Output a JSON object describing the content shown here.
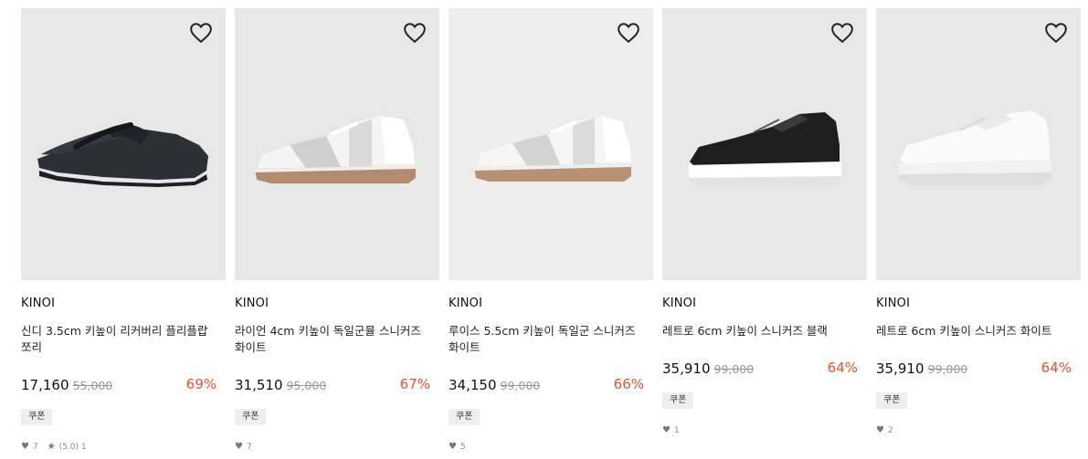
{
  "products": [
    {
      "brand": "KINOI",
      "name": "신디 3.5cm 키높이 리커버리 플리플랍 쪼리",
      "price": "17,160",
      "original_price": "55,000",
      "discount": "69%",
      "coupon": "쿠폰",
      "likes": "7",
      "rating": "(5.0) 1",
      "icon": "heart-outline-icon"
    },
    {
      "brand": "KINOI",
      "name": "라이언 4cm 키높이 독일군뮬 스니커즈 화이트",
      "price": "31,510",
      "original_price": "95,000",
      "discount": "67%",
      "coupon": "쿠폰",
      "likes": "7",
      "icon": "heart-outline-icon"
    },
    {
      "brand": "KINOI",
      "name": "루이스 5.5cm 키높이 독일군 스니커즈 화이트",
      "price": "34,150",
      "original_price": "99,000",
      "discount": "66%",
      "coupon": "쿠폰",
      "likes": "5",
      "icon": "heart-outline-icon"
    },
    {
      "brand": "KINOI",
      "name": "레트로 6cm 키높이 스니커즈 블랙",
      "price": "35,910",
      "original_price": "99,000",
      "discount": "64%",
      "coupon": "쿠폰",
      "likes": "1",
      "icon": "heart-outline-icon"
    },
    {
      "brand": "KINOI",
      "name": "레트로 6cm 키높이 스니커즈 화이트",
      "price": "35,910",
      "original_price": "99,000",
      "discount": "64%",
      "coupon": "쿠폰",
      "likes": "2",
      "icon": "heart-outline-icon"
    }
  ],
  "colors": {
    "discount": "#e8502f",
    "thumb_bg": "#e7e7e7",
    "coupon_bg": "#eeeeee"
  }
}
